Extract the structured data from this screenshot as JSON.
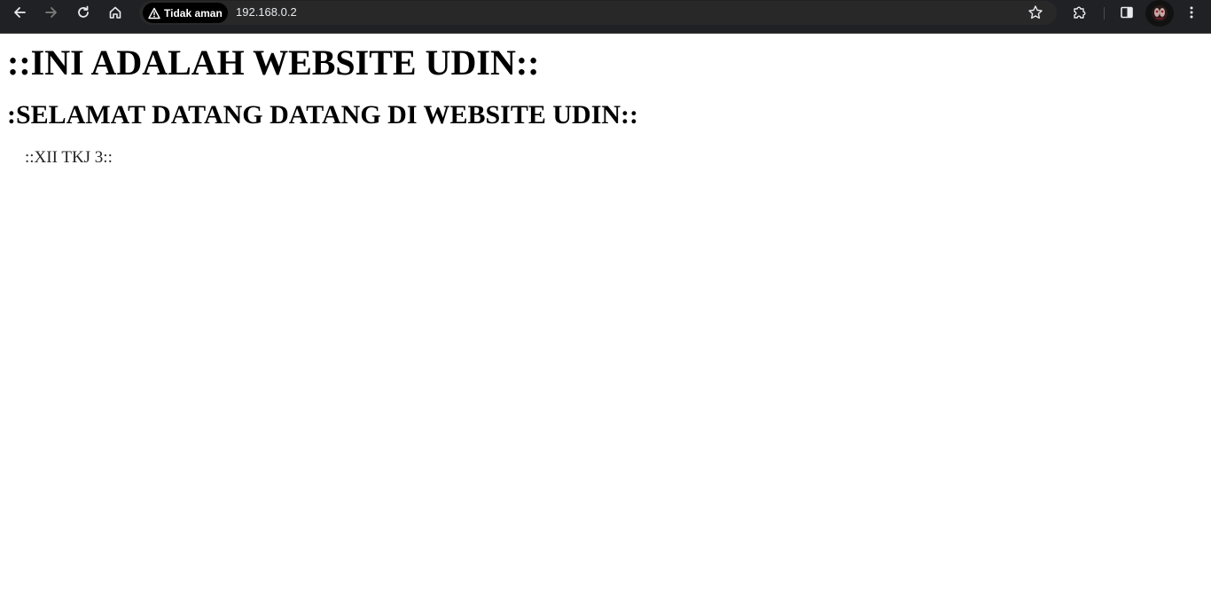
{
  "browser": {
    "security_label": "Tidak aman",
    "url": "192.168.0.2",
    "icons": {
      "back": "back-arrow-icon",
      "forward": "forward-arrow-icon",
      "reload": "reload-icon",
      "home": "home-icon",
      "warning": "warning-triangle-icon",
      "bookmark": "star-icon",
      "extensions": "puzzle-icon",
      "side_panel": "side-panel-icon",
      "menu": "kebab-menu-icon"
    },
    "colors": {
      "toolbar_bg": "#202124",
      "omnibox_bg": "#282828",
      "chip_bg": "#000000",
      "icon_color": "#e8eaed",
      "forward_disabled": "#7d7d7d"
    }
  },
  "page": {
    "title": "::INI ADALAH WEBSITE UDIN::",
    "subtitle": ":SELAMAT DATANG DATANG DI WEBSITE UDIN::",
    "class_label": "::XII TKJ 3::"
  }
}
